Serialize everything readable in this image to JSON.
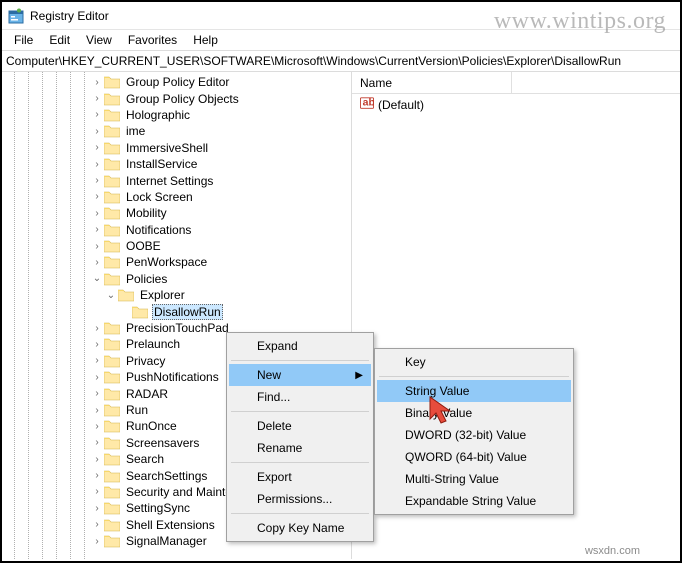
{
  "watermark": "www.wintips.org",
  "footermark": "wsxdn.com",
  "window": {
    "title": "Registry Editor"
  },
  "menubar": [
    "File",
    "Edit",
    "View",
    "Favorites",
    "Help"
  ],
  "address": "Computer\\HKEY_CURRENT_USER\\SOFTWARE\\Microsoft\\Windows\\CurrentVersion\\Policies\\Explorer\\DisallowRun",
  "listpane": {
    "header_name": "Name",
    "default_row": "(Default)"
  },
  "tree": {
    "selected": "DisallowRun",
    "items": [
      {
        "depth": 6,
        "chev": "closed",
        "label": "Group Policy Editor"
      },
      {
        "depth": 6,
        "chev": "closed",
        "label": "Group Policy Objects"
      },
      {
        "depth": 6,
        "chev": "closed",
        "label": "Holographic"
      },
      {
        "depth": 6,
        "chev": "closed",
        "label": "ime"
      },
      {
        "depth": 6,
        "chev": "closed",
        "label": "ImmersiveShell"
      },
      {
        "depth": 6,
        "chev": "closed",
        "label": "InstallService"
      },
      {
        "depth": 6,
        "chev": "closed",
        "label": "Internet Settings"
      },
      {
        "depth": 6,
        "chev": "closed",
        "label": "Lock Screen"
      },
      {
        "depth": 6,
        "chev": "closed",
        "label": "Mobility"
      },
      {
        "depth": 6,
        "chev": "closed",
        "label": "Notifications"
      },
      {
        "depth": 6,
        "chev": "closed",
        "label": "OOBE"
      },
      {
        "depth": 6,
        "chev": "closed",
        "label": "PenWorkspace"
      },
      {
        "depth": 6,
        "chev": "open",
        "label": "Policies"
      },
      {
        "depth": 7,
        "chev": "open",
        "label": "Explorer"
      },
      {
        "depth": 8,
        "chev": "none",
        "label": "DisallowRun",
        "selected": true
      },
      {
        "depth": 6,
        "chev": "closed",
        "label": "PrecisionTouchPad"
      },
      {
        "depth": 6,
        "chev": "closed",
        "label": "Prelaunch"
      },
      {
        "depth": 6,
        "chev": "closed",
        "label": "Privacy"
      },
      {
        "depth": 6,
        "chev": "closed",
        "label": "PushNotifications"
      },
      {
        "depth": 6,
        "chev": "closed",
        "label": "RADAR"
      },
      {
        "depth": 6,
        "chev": "closed",
        "label": "Run"
      },
      {
        "depth": 6,
        "chev": "closed",
        "label": "RunOnce"
      },
      {
        "depth": 6,
        "chev": "closed",
        "label": "Screensavers"
      },
      {
        "depth": 6,
        "chev": "closed",
        "label": "Search"
      },
      {
        "depth": 6,
        "chev": "closed",
        "label": "SearchSettings"
      },
      {
        "depth": 6,
        "chev": "closed",
        "label": "Security and Maintenance"
      },
      {
        "depth": 6,
        "chev": "closed",
        "label": "SettingSync"
      },
      {
        "depth": 6,
        "chev": "closed",
        "label": "Shell Extensions"
      },
      {
        "depth": 6,
        "chev": "closed",
        "label": "SignalManager"
      }
    ]
  },
  "context_menu_1": {
    "items": [
      {
        "label": "Expand",
        "type": "item"
      },
      {
        "type": "sep"
      },
      {
        "label": "New",
        "type": "item",
        "highlight": true,
        "submenu": true
      },
      {
        "label": "Find...",
        "type": "item"
      },
      {
        "type": "sep"
      },
      {
        "label": "Delete",
        "type": "item"
      },
      {
        "label": "Rename",
        "type": "item"
      },
      {
        "type": "sep"
      },
      {
        "label": "Export",
        "type": "item"
      },
      {
        "label": "Permissions...",
        "type": "item"
      },
      {
        "type": "sep"
      },
      {
        "label": "Copy Key Name",
        "type": "item"
      }
    ]
  },
  "context_menu_2": {
    "items": [
      {
        "label": "Key",
        "type": "item"
      },
      {
        "type": "sep"
      },
      {
        "label": "String Value",
        "type": "item",
        "highlight": true
      },
      {
        "label": "Binary Value",
        "type": "item"
      },
      {
        "label": "DWORD (32-bit) Value",
        "type": "item"
      },
      {
        "label": "QWORD (64-bit) Value",
        "type": "item"
      },
      {
        "label": "Multi-String Value",
        "type": "item"
      },
      {
        "label": "Expandable String Value",
        "type": "item"
      }
    ]
  }
}
